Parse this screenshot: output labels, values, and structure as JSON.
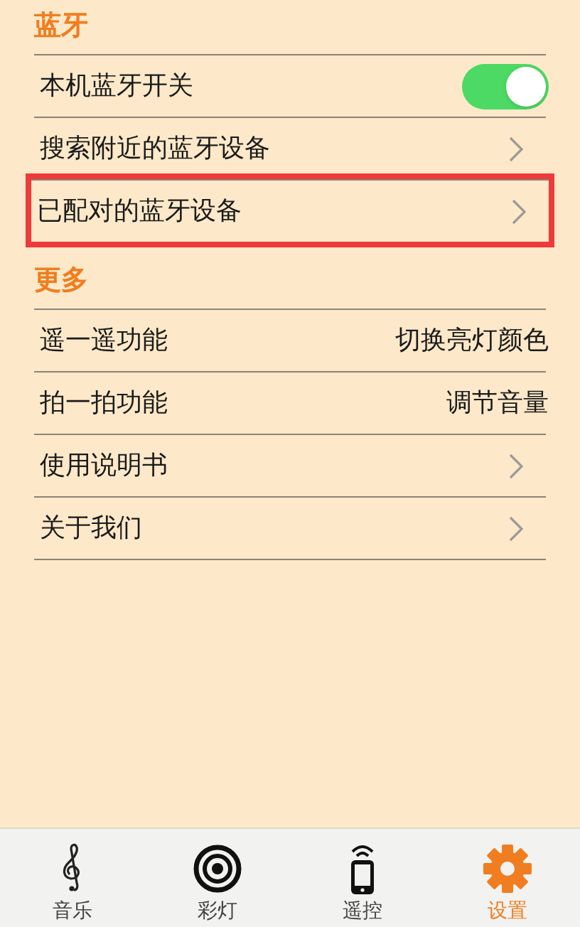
{
  "sections": [
    {
      "title": "蓝牙",
      "rows": [
        {
          "kind": "toggle",
          "label": "本机蓝牙开关",
          "on": true,
          "highlighted": false
        },
        {
          "kind": "link",
          "label": "搜索附近的蓝牙设备",
          "highlighted": false
        },
        {
          "kind": "link",
          "label": "已配对的蓝牙设备",
          "highlighted": true
        }
      ]
    },
    {
      "title": "更多",
      "rows": [
        {
          "kind": "value",
          "label": "遥一遥功能",
          "value": "切换亮灯颜色",
          "highlighted": false
        },
        {
          "kind": "value",
          "label": "拍一拍功能",
          "value": "调节音量",
          "highlighted": false
        },
        {
          "kind": "link",
          "label": "使用说明书",
          "highlighted": false
        },
        {
          "kind": "link",
          "label": "关于我们",
          "highlighted": false
        }
      ]
    }
  ],
  "tab_bar": [
    {
      "kind": "music",
      "label": "音乐",
      "selected": false
    },
    {
      "kind": "lights",
      "label": "彩灯",
      "selected": false
    },
    {
      "kind": "remote",
      "label": "遥控",
      "selected": false
    },
    {
      "kind": "settings",
      "label": "设置",
      "selected": true
    }
  ]
}
